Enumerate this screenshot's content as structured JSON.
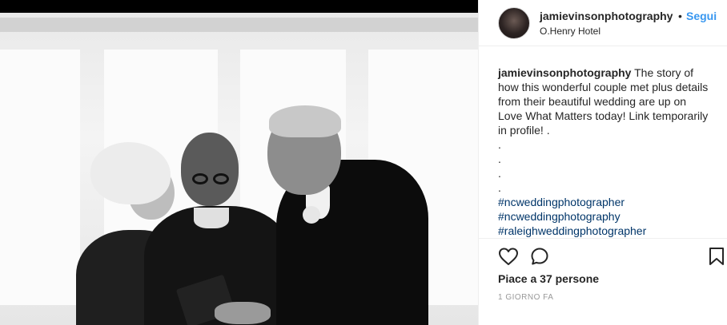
{
  "post": {
    "photo_alt": "wedding-ceremony-photo"
  },
  "header": {
    "username": "jamievinsonphotography",
    "separator": "•",
    "follow_label": "Segui",
    "location": "O.Henry Hotel"
  },
  "caption": {
    "username": "jamievinsonphotography",
    "text": "The story of how this wonderful couple met plus details from their beautiful wedding are up on Love What Matters today! Link temporarily in profile! .",
    "dots": [
      ".",
      ".",
      ".",
      "."
    ],
    "hashtags": [
      "#ncweddingphotographer",
      "#ncweddingphotography",
      "#raleighweddingphotographer"
    ]
  },
  "actions": {
    "like_icon": "heart-icon",
    "comment_icon": "comment-icon",
    "save_icon": "bookmark-icon",
    "likes_text": "Piace a 37 persone",
    "timestamp": "1 GIORNO FA"
  },
  "colors": {
    "link": "#3897f0",
    "hashtag": "#003569",
    "text": "#262626",
    "muted": "#999999"
  }
}
